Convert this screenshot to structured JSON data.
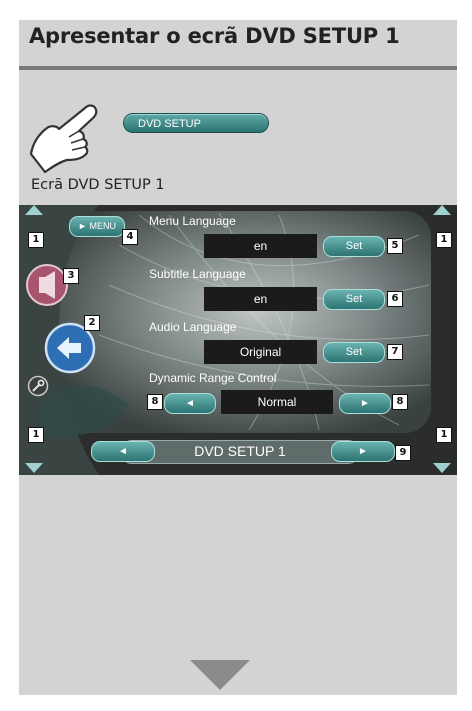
{
  "heading": "Apresentar o ecrã DVD SETUP 1",
  "touch_button_label": "DVD SETUP",
  "caption": "Ecrã DVD SETUP 1",
  "screen": {
    "menu_label": "MENU",
    "items": [
      {
        "label": "Menu Language",
        "value": "en",
        "button": "Set"
      },
      {
        "label": "Subtitle Language",
        "value": "en",
        "button": "Set"
      },
      {
        "label": "Audio Language",
        "value": "Original",
        "button": "Set"
      }
    ],
    "drc_label": "Dynamic Range Control",
    "drc_value": "Normal",
    "bottom_title": "DVD SETUP 1"
  },
  "callouts": {
    "c1": "1",
    "c2": "2",
    "c3": "3",
    "c4": "4",
    "c5": "5",
    "c6": "6",
    "c7": "7",
    "c8": "8",
    "c9": "9"
  },
  "colors": {
    "accent": "#2d7472",
    "panel": "#d3d3d3",
    "rule": "#7a7a7a"
  }
}
